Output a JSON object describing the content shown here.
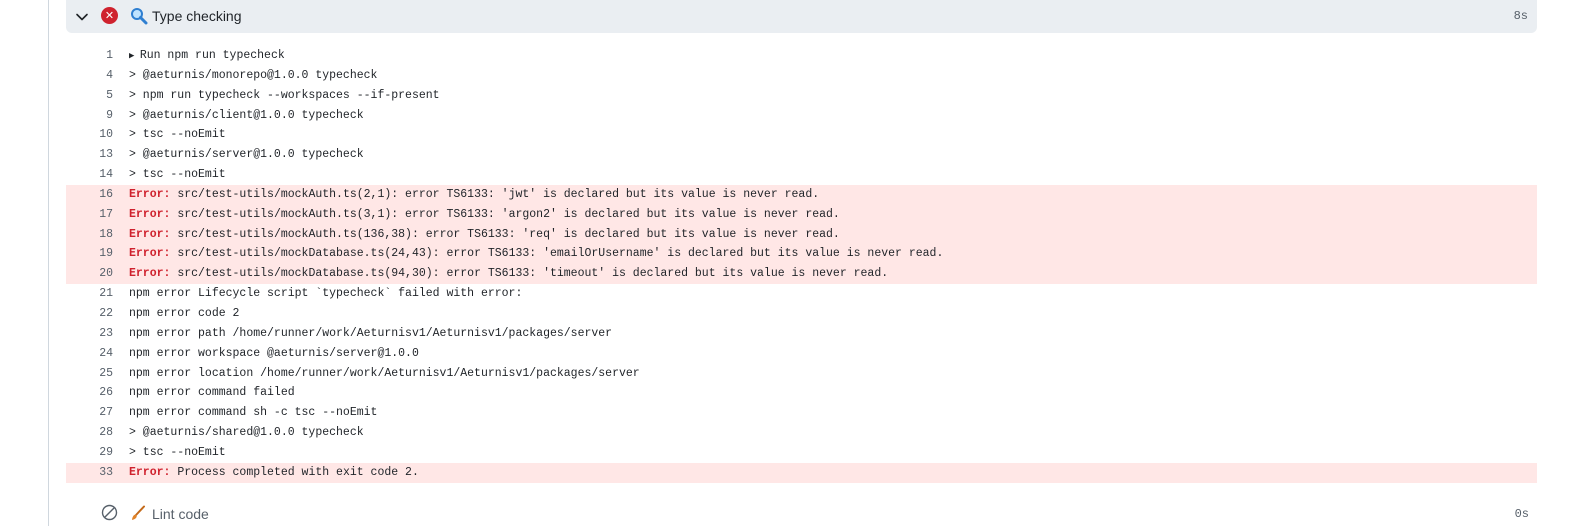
{
  "step": {
    "title": "Type checking",
    "time": "8s",
    "status_icon": "x-circle-icon",
    "emoji_icon": "magnifying-glass-icon"
  },
  "log_lines": [
    {
      "n": "1",
      "prefix": "▶ ",
      "text": "Run npm run typecheck",
      "error": false
    },
    {
      "n": "4",
      "prefix": "",
      "text": "> @aeturnis/monorepo@1.0.0 typecheck",
      "error": false
    },
    {
      "n": "5",
      "prefix": "",
      "text": "> npm run typecheck --workspaces --if-present",
      "error": false
    },
    {
      "n": "9",
      "prefix": "",
      "text": "> @aeturnis/client@1.0.0 typecheck",
      "error": false
    },
    {
      "n": "10",
      "prefix": "",
      "text": "> tsc --noEmit",
      "error": false
    },
    {
      "n": "13",
      "prefix": "",
      "text": "> @aeturnis/server@1.0.0 typecheck",
      "error": false
    },
    {
      "n": "14",
      "prefix": "",
      "text": "> tsc --noEmit",
      "error": false
    },
    {
      "n": "16",
      "prefix": "Error:",
      "text": " src/test-utils/mockAuth.ts(2,1): error TS6133: 'jwt' is declared but its value is never read.",
      "error": true
    },
    {
      "n": "17",
      "prefix": "Error:",
      "text": " src/test-utils/mockAuth.ts(3,1): error TS6133: 'argon2' is declared but its value is never read.",
      "error": true
    },
    {
      "n": "18",
      "prefix": "Error:",
      "text": " src/test-utils/mockAuth.ts(136,38): error TS6133: 'req' is declared but its value is never read.",
      "error": true
    },
    {
      "n": "19",
      "prefix": "Error:",
      "text": " src/test-utils/mockDatabase.ts(24,43): error TS6133: 'emailOrUsername' is declared but its value is never read.",
      "error": true
    },
    {
      "n": "20",
      "prefix": "Error:",
      "text": " src/test-utils/mockDatabase.ts(94,30): error TS6133: 'timeout' is declared but its value is never read.",
      "error": true
    },
    {
      "n": "21",
      "prefix": "",
      "text": "npm error Lifecycle script `typecheck` failed with error:",
      "error": false
    },
    {
      "n": "22",
      "prefix": "",
      "text": "npm error code 2",
      "error": false
    },
    {
      "n": "23",
      "prefix": "",
      "text": "npm error path /home/runner/work/Aeturnisv1/Aeturnisv1/packages/server",
      "error": false
    },
    {
      "n": "24",
      "prefix": "",
      "text": "npm error workspace @aeturnis/server@1.0.0",
      "error": false
    },
    {
      "n": "25",
      "prefix": "",
      "text": "npm error location /home/runner/work/Aeturnisv1/Aeturnisv1/packages/server",
      "error": false
    },
    {
      "n": "26",
      "prefix": "",
      "text": "npm error command failed",
      "error": false
    },
    {
      "n": "27",
      "prefix": "",
      "text": "npm error command sh -c tsc --noEmit",
      "error": false
    },
    {
      "n": "28",
      "prefix": "",
      "text": "> @aeturnis/shared@1.0.0 typecheck",
      "error": false
    },
    {
      "n": "29",
      "prefix": "",
      "text": "> tsc --noEmit",
      "error": false
    },
    {
      "n": "33",
      "prefix": "Error:",
      "text": " Process completed with exit code 2.",
      "error": true
    }
  ],
  "next_step": {
    "title": "Lint code",
    "time": "0s",
    "status_icon": "skipped-icon",
    "emoji_icon": "paintbrush-icon"
  }
}
